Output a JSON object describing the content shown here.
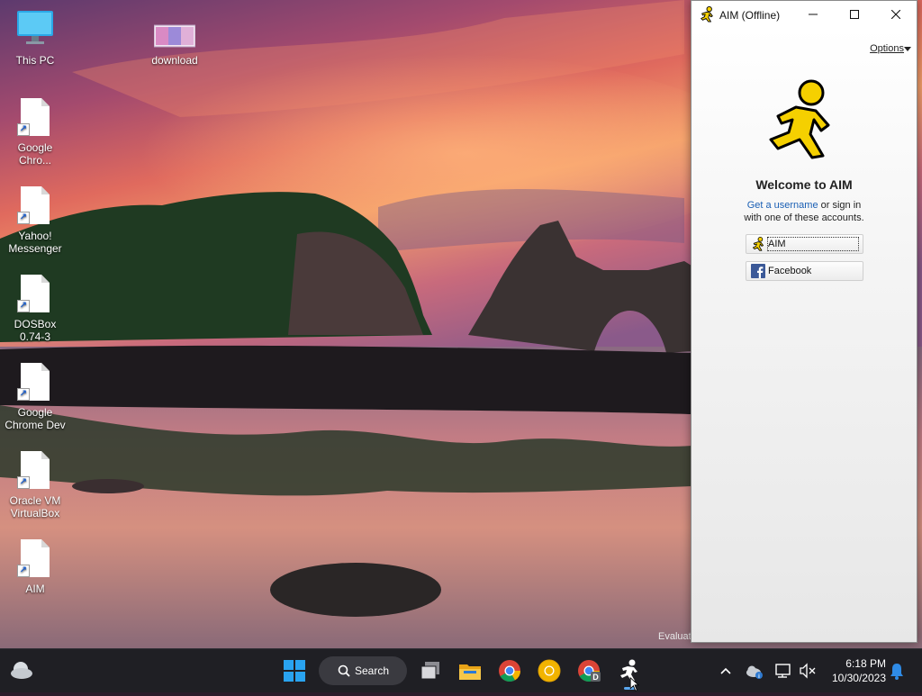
{
  "desktop": {
    "icons": [
      {
        "label": "This PC",
        "icon": "monitor-icon"
      },
      {
        "label": "download",
        "icon": "image-thumbnail-icon"
      },
      {
        "label": "Google Chro...",
        "icon": "file-shortcut-icon"
      },
      {
        "label": "Yahoo! Messenger",
        "icon": "file-shortcut-icon"
      },
      {
        "label": "DOSBox 0.74-3",
        "icon": "file-shortcut-icon"
      },
      {
        "label": "Google Chrome Dev",
        "icon": "file-shortcut-icon"
      },
      {
        "label": "Oracle VM VirtualBox",
        "icon": "file-shortcut-icon"
      },
      {
        "label": "AIM",
        "icon": "file-shortcut-icon"
      }
    ],
    "watermark": "Evaluat"
  },
  "aim_window": {
    "title": "AIM (Offline)",
    "options_label": "Options",
    "welcome": "Welcome to AIM",
    "get_username_link": "Get a username",
    "signin_text_1": "or sign in",
    "signin_text_2": "with one of these accounts.",
    "accounts": [
      {
        "label": "AIM",
        "icon": "aim-runner-icon"
      },
      {
        "label": "Facebook",
        "icon": "facebook-icon"
      }
    ],
    "colors": {
      "aim_yellow": "#f5d000",
      "facebook_blue": "#3b5998",
      "link_blue": "#1a5fb4"
    }
  },
  "taskbar": {
    "search_label": "Search",
    "time": "6:18 PM",
    "date": "10/30/2023",
    "apps": [
      "windows-start-icon",
      "task-view-icon",
      "file-explorer-icon",
      "chrome-icon",
      "chrome-canary-icon",
      "chrome-dev-icon",
      "aim-runner-icon"
    ],
    "tray": [
      "chevron-up-icon",
      "onedrive-icon",
      "network-icon",
      "volume-muted-icon",
      "notification-bell-icon"
    ]
  }
}
